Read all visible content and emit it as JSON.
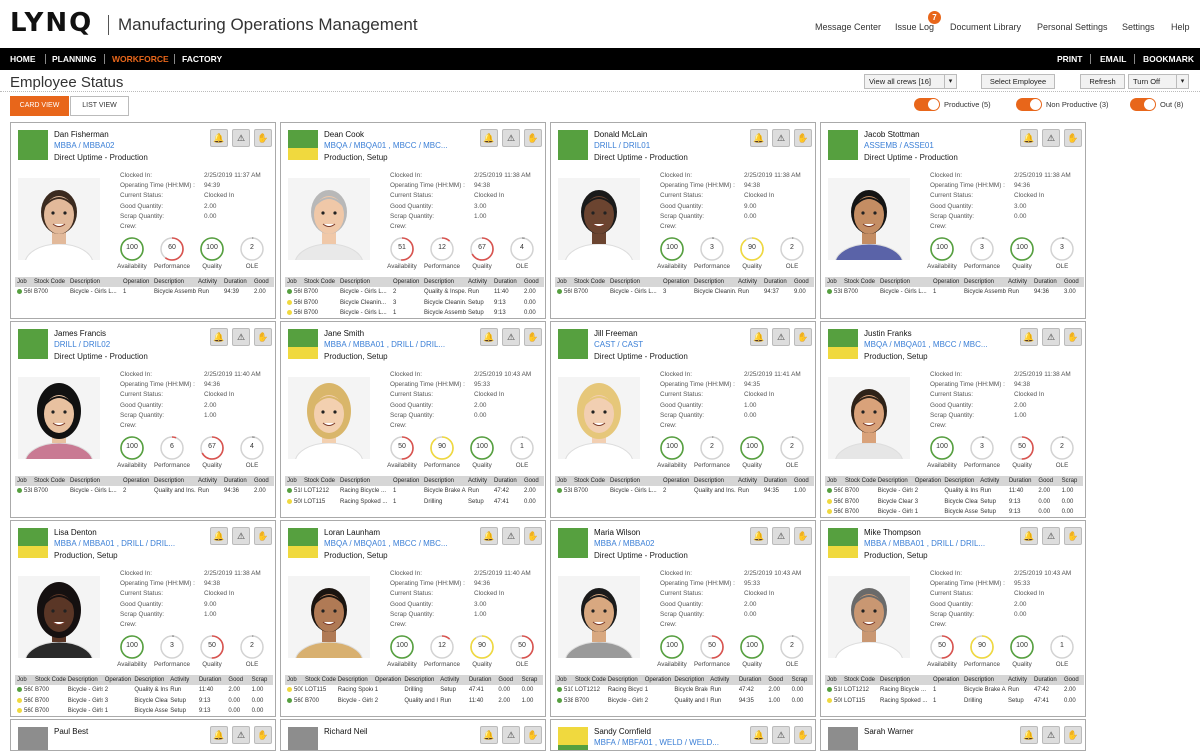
{
  "header": {
    "logo": "LYNQ",
    "title": "Manufacturing Operations Management",
    "nav": [
      "Message Center",
      "Issue Log",
      "Document Library",
      "Personal Settings",
      "Settings",
      "Help"
    ],
    "issue_badge": "7"
  },
  "menu": {
    "items": [
      "HOME",
      "PLANNING",
      "WORKFORCE",
      "FACTORY"
    ],
    "active": "WORKFORCE",
    "right": [
      "PRINT",
      "EMAIL",
      "BOOKMARK"
    ]
  },
  "statusbar": {
    "title": "Employee Status",
    "crew_select": "View all crews [16]",
    "select_employee": "Select Employee",
    "refresh": "Refresh",
    "refresh_select": "Turn Off"
  },
  "views": {
    "card": "CARD VIEW",
    "list": "LIST VIEW"
  },
  "toggles": [
    {
      "label": "Productive (5)",
      "on": true
    },
    {
      "label": "Non Productive (3)",
      "on": true
    },
    {
      "label": "Out (8)",
      "on": true
    }
  ],
  "field_labels": [
    "Clocked In:",
    "Operating Time (HH:MM) :",
    "Current Status:",
    "Good Quantity:",
    "Scrap Quantity:",
    "Crew:"
  ],
  "gauge_labels": [
    "Availability",
    "Performance",
    "Quality",
    "OLE"
  ],
  "job_columns": [
    "Job",
    "Stock Code",
    "Description",
    "Operation",
    "Description",
    "Activity",
    "Duration",
    "Good"
  ],
  "job_columns_wide": [
    "Job",
    "Stock Code",
    "Description",
    "Operation",
    "Description",
    "Activity",
    "Duration",
    "Good",
    "Scrap"
  ],
  "colors": {
    "green": "#56a03f",
    "yellow": "#f0d93e",
    "orange": "#e8661a",
    "red": "#d9534f",
    "link": "#3b7fd6"
  },
  "employees": [
    {
      "name": "Dan Fisherman",
      "codes": "MBBA / MBBA02",
      "status": "Direct Uptime - Production",
      "swatch": "green",
      "clocked": "2/25/2019 11:37 AM",
      "optime": "94:39",
      "cur": "Clocked In",
      "good": "2.00",
      "scrap": "0.00",
      "gauges": [
        {
          "v": "100",
          "c": "green",
          "p": 1
        },
        {
          "v": "60",
          "c": "red",
          "p": 0.6
        },
        {
          "v": "100",
          "c": "green",
          "p": 1
        },
        {
          "v": "2",
          "c": "grey",
          "p": 0.02
        }
      ],
      "wide": false,
      "jobs": [
        {
          "dot": "green",
          "cells": [
            "560",
            "B700",
            "Bicycle - Girls L...",
            "1",
            "Bicycle Assembly",
            "Run",
            "94:39",
            "2.00"
          ]
        }
      ]
    },
    {
      "name": "Dean Cook",
      "codes": "MBQA / MBQA01 ,  MBCC / MBC...",
      "status": "Production, Setup",
      "swatch": "split",
      "clocked": "2/25/2019 11:38 AM",
      "optime": "94:38",
      "cur": "Clocked In",
      "good": "3.00",
      "scrap": "1.00",
      "gauges": [
        {
          "v": "51",
          "c": "red",
          "p": 0.51
        },
        {
          "v": "12",
          "c": "red",
          "p": 0.12
        },
        {
          "v": "67",
          "c": "red",
          "p": 0.67
        },
        {
          "v": "4",
          "c": "grey",
          "p": 0.04
        }
      ],
      "wide": false,
      "jobs": [
        {
          "dot": "green",
          "cells": [
            "560",
            "B700",
            "Bicycle - Girls L...",
            "2",
            "Quality & Inspe...",
            "Run",
            "11:40",
            "2.00"
          ]
        },
        {
          "dot": "yellow",
          "cells": [
            "560",
            "B700",
            "Bicycle Cleanin...",
            "3",
            "Bicycle Cleanin...",
            "Setup",
            "9:13",
            "0.00"
          ]
        },
        {
          "dot": "yellow",
          "cells": [
            "560",
            "B700",
            "Bicycle - Girls L...",
            "1",
            "Bicycle Assembly",
            "Setup",
            "9:13",
            "0.00"
          ]
        }
      ]
    },
    {
      "name": "Donald McLain",
      "codes": "DRILL / DRIL01",
      "status": "Direct Uptime - Production",
      "swatch": "green",
      "clocked": "2/25/2019 11:38 AM",
      "optime": "94:38",
      "cur": "Clocked In",
      "good": "9.00",
      "scrap": "0.00",
      "gauges": [
        {
          "v": "100",
          "c": "green",
          "p": 1
        },
        {
          "v": "3",
          "c": "grey",
          "p": 0.03
        },
        {
          "v": "90",
          "c": "yellow",
          "p": 0.9
        },
        {
          "v": "2",
          "c": "grey",
          "p": 0.02
        }
      ],
      "wide": false,
      "jobs": [
        {
          "dot": "green",
          "cells": [
            "560",
            "B700",
            "Bicycle - Girls L...",
            "3",
            "Bicycle Cleanin...",
            "Run",
            "94:37",
            "9.00"
          ]
        }
      ]
    },
    {
      "name": "Jacob Stottman",
      "codes": "ASSEMB / ASSE01",
      "status": "Direct Uptime - Production",
      "swatch": "green",
      "clocked": "2/25/2019 11:38 AM",
      "optime": "94:36",
      "cur": "Clocked In",
      "good": "3.00",
      "scrap": "0.00",
      "gauges": [
        {
          "v": "100",
          "c": "green",
          "p": 1
        },
        {
          "v": "3",
          "c": "grey",
          "p": 0.03
        },
        {
          "v": "100",
          "c": "green",
          "p": 1
        },
        {
          "v": "3",
          "c": "grey",
          "p": 0.03
        }
      ],
      "wide": false,
      "jobs": [
        {
          "dot": "green",
          "cells": [
            "538",
            "B700",
            "Bicycle - Girls L...",
            "1",
            "Bicycle Assembly",
            "Run",
            "94:36",
            "3.00"
          ]
        }
      ]
    },
    {
      "name": "James Francis",
      "codes": "DRILL / DRIL02",
      "status": "Direct Uptime - Production",
      "swatch": "green",
      "clocked": "2/25/2019 11:40 AM",
      "optime": "94:36",
      "cur": "Clocked In",
      "good": "2.00",
      "scrap": "1.00",
      "gauges": [
        {
          "v": "100",
          "c": "green",
          "p": 1
        },
        {
          "v": "6",
          "c": "red",
          "p": 0.06
        },
        {
          "v": "67",
          "c": "red",
          "p": 0.67
        },
        {
          "v": "4",
          "c": "grey",
          "p": 0.04
        }
      ],
      "wide": false,
      "jobs": [
        {
          "dot": "green",
          "cells": [
            "538",
            "B700",
            "Bicycle - Girls L...",
            "2",
            "Quality and Ins...",
            "Run",
            "94:36",
            "2.00"
          ]
        }
      ]
    },
    {
      "name": "Jane Smith",
      "codes": "MBBA / MBBA01 ,  DRILL / DRIL...",
      "status": "Production, Setup",
      "swatch": "split",
      "clocked": "2/25/2019 10:43 AM",
      "optime": "95:33",
      "cur": "Clocked In",
      "good": "2.00",
      "scrap": "0.00",
      "gauges": [
        {
          "v": "50",
          "c": "red",
          "p": 0.5
        },
        {
          "v": "90",
          "c": "yellow",
          "p": 0.9
        },
        {
          "v": "100",
          "c": "green",
          "p": 1
        },
        {
          "v": "1",
          "c": "grey",
          "p": 0.01
        }
      ],
      "wide": false,
      "jobs": [
        {
          "dot": "green",
          "cells": [
            "510",
            "LOT1212",
            "Racing Bicycle ...",
            "1",
            "Bicycle Brake A...",
            "Run",
            "47:42",
            "2.00"
          ]
        },
        {
          "dot": "yellow",
          "cells": [
            "500",
            "LOT115",
            "Racing Spoked ...",
            "1",
            "Drilling",
            "Setup",
            "47:41",
            "0.00"
          ]
        }
      ]
    },
    {
      "name": "Jill Freeman",
      "codes": "CAST / CAST",
      "status": "Direct Uptime - Production",
      "swatch": "green",
      "clocked": "2/25/2019 11:41 AM",
      "optime": "94:35",
      "cur": "Clocked In",
      "good": "1.00",
      "scrap": "0.00",
      "gauges": [
        {
          "v": "100",
          "c": "green",
          "p": 1
        },
        {
          "v": "2",
          "c": "grey",
          "p": 0.02
        },
        {
          "v": "100",
          "c": "green",
          "p": 1
        },
        {
          "v": "2",
          "c": "grey",
          "p": 0.02
        }
      ],
      "wide": false,
      "jobs": [
        {
          "dot": "green",
          "cells": [
            "538",
            "B700",
            "Bicycle - Girls L...",
            "2",
            "Quality and Ins...",
            "Run",
            "94:35",
            "1.00"
          ]
        }
      ]
    },
    {
      "name": "Justin Franks",
      "codes": "MBQA / MBQA01 ,  MBCC / MBC...",
      "status": "Production, Setup",
      "swatch": "split",
      "clocked": "2/25/2019 11:38 AM",
      "optime": "94:38",
      "cur": "Clocked In",
      "good": "2.00",
      "scrap": "1.00",
      "gauges": [
        {
          "v": "100",
          "c": "green",
          "p": 1
        },
        {
          "v": "3",
          "c": "grey",
          "p": 0.03
        },
        {
          "v": "50",
          "c": "red",
          "p": 0.5
        },
        {
          "v": "2",
          "c": "grey",
          "p": 0.02
        }
      ],
      "wide": true,
      "jobs": [
        {
          "dot": "green",
          "cells": [
            "560",
            "B700",
            "Bicycle - Girls ...",
            "2",
            "Quality & Inspe...",
            "Run",
            "11:40",
            "2.00",
            "1.00"
          ]
        },
        {
          "dot": "yellow",
          "cells": [
            "560",
            "B700",
            "Bicycle Cleani...",
            "3",
            "Bicycle Cleanin...",
            "Setup",
            "9:13",
            "0.00",
            "0.00"
          ]
        },
        {
          "dot": "yellow",
          "cells": [
            "560",
            "B700",
            "Bicycle - Girls ...",
            "1",
            "Bicycle Assembly",
            "Setup",
            "9:13",
            "0.00",
            "0.00"
          ]
        }
      ]
    },
    {
      "name": "Lisa Denton",
      "codes": "MBBA / MBBA01 ,  DRILL / DRIL...",
      "status": "Production, Setup",
      "swatch": "split",
      "clocked": "2/25/2019 11:38 AM",
      "optime": "94:38",
      "cur": "Clocked In",
      "good": "9.00",
      "scrap": "1.00",
      "gauges": [
        {
          "v": "100",
          "c": "green",
          "p": 1
        },
        {
          "v": "3",
          "c": "grey",
          "p": 0.03
        },
        {
          "v": "50",
          "c": "red",
          "p": 0.5
        },
        {
          "v": "2",
          "c": "grey",
          "p": 0.02
        }
      ],
      "wide": true,
      "jobs": [
        {
          "dot": "green",
          "cells": [
            "560",
            "B700",
            "Bicycle - Girls L...",
            "2",
            "Quality & Inspe...",
            "Run",
            "11:40",
            "2.00",
            "1.00"
          ]
        },
        {
          "dot": "yellow",
          "cells": [
            "560",
            "B700",
            "Bicycle - Girls L...",
            "3",
            "Bicycle Cleanin...",
            "Setup",
            "9:13",
            "0.00",
            "0.00"
          ]
        },
        {
          "dot": "yellow",
          "cells": [
            "560",
            "B700",
            "Bicycle - Girls L...",
            "1",
            "Bicycle Assembly",
            "Setup",
            "9:13",
            "0.00",
            "0.00"
          ]
        }
      ]
    },
    {
      "name": "Loran Launham",
      "codes": "MBQA / MBQA01 ,  MBCC / MBC...",
      "status": "Production, Setup",
      "swatch": "split",
      "clocked": "2/25/2019 11:40 AM",
      "optime": "94:36",
      "cur": "Clocked In",
      "good": "3.00",
      "scrap": "1.00",
      "gauges": [
        {
          "v": "100",
          "c": "green",
          "p": 1
        },
        {
          "v": "12",
          "c": "red",
          "p": 0.12
        },
        {
          "v": "90",
          "c": "yellow",
          "p": 0.9
        },
        {
          "v": "50",
          "c": "red",
          "p": 0.5
        }
      ],
      "wide": true,
      "jobs": [
        {
          "dot": "yellow",
          "cells": [
            "500",
            "LOT115",
            "Racing Spoked ...",
            "1",
            "Drilling",
            "Setup",
            "47:41",
            "0.00",
            "0.00"
          ]
        },
        {
          "dot": "green",
          "cells": [
            "560",
            "B700",
            "Bicycle - Girls L...",
            "2",
            "Quality and Ins...",
            "Run",
            "11:40",
            "2.00",
            "1.00"
          ]
        }
      ]
    },
    {
      "name": "Maria Wilson",
      "codes": "MBBA / MBBA02",
      "status": "Direct Uptime - Production",
      "swatch": "green",
      "clocked": "2/25/2019 10:43 AM",
      "optime": "95:33",
      "cur": "Clocked In",
      "good": "2.00",
      "scrap": "0.00",
      "gauges": [
        {
          "v": "100",
          "c": "green",
          "p": 1
        },
        {
          "v": "50",
          "c": "red",
          "p": 0.5
        },
        {
          "v": "100",
          "c": "green",
          "p": 1
        },
        {
          "v": "2",
          "c": "grey",
          "p": 0.02
        }
      ],
      "wide": true,
      "jobs": [
        {
          "dot": "green",
          "cells": [
            "510",
            "LOT1212",
            "Racing Bicycle ...",
            "1",
            "Bicycle Brake A...",
            "Run",
            "47:42",
            "2.00",
            "0.00"
          ]
        },
        {
          "dot": "green",
          "cells": [
            "538",
            "B700",
            "Bicycle - Girls L...",
            "2",
            "Quality and Ins...",
            "Run",
            "94:35",
            "1.00",
            "0.00"
          ]
        }
      ]
    },
    {
      "name": "Mike Thompson",
      "codes": "MBBA / MBBA01 ,  DRILL / DRIL...",
      "status": "Production, Setup",
      "swatch": "split",
      "clocked": "2/25/2019 10:43 AM",
      "optime": "95:33",
      "cur": "Clocked In",
      "good": "2.00",
      "scrap": "0.00",
      "gauges": [
        {
          "v": "50",
          "c": "red",
          "p": 0.5
        },
        {
          "v": "90",
          "c": "yellow",
          "p": 0.9
        },
        {
          "v": "100",
          "c": "green",
          "p": 1
        },
        {
          "v": "1",
          "c": "grey",
          "p": 0.01
        }
      ],
      "wide": false,
      "jobs": [
        {
          "dot": "green",
          "cells": [
            "510",
            "LOT1212",
            "Racing Bicycle ...",
            "1",
            "Bicycle Brake A...",
            "Run",
            "47:42",
            "2.00"
          ]
        },
        {
          "dot": "yellow",
          "cells": [
            "500",
            "LOT115",
            "Racing Spoked ...",
            "1",
            "Drilling",
            "Setup",
            "47:41",
            "0.00"
          ]
        }
      ]
    },
    {
      "name": "Paul Best",
      "codes": "",
      "status": "",
      "swatch": "grey",
      "partial": true
    },
    {
      "name": "Richard Neil",
      "codes": "",
      "status": "",
      "swatch": "grey",
      "partial": true
    },
    {
      "name": "Sandy Cornfield",
      "codes": "MBFA / MBFA01 ,  WELD / WELD...",
      "status": "",
      "swatch": "yellow",
      "partial": true
    },
    {
      "name": "Sarah Warner",
      "codes": "",
      "status": "",
      "swatch": "grey",
      "partial": true
    }
  ]
}
